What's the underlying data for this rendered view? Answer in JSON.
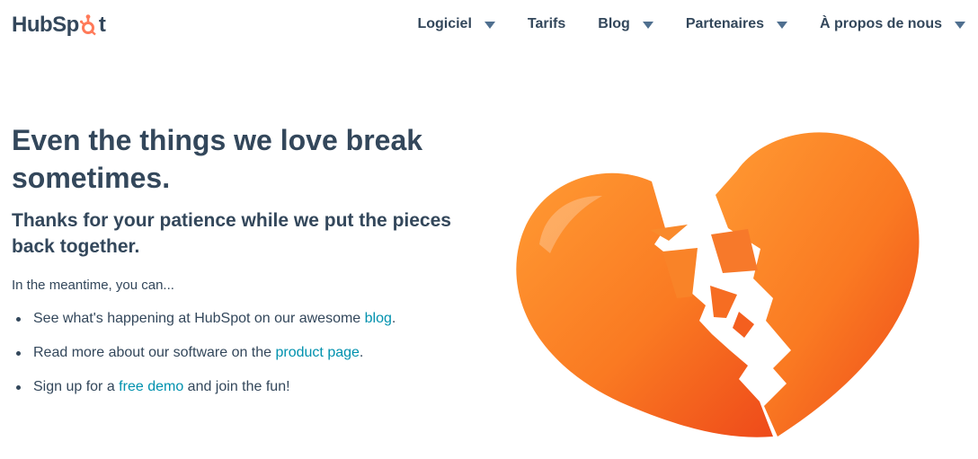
{
  "brand": {
    "logo_text_left": "HubSp",
    "logo_text_right": "t",
    "accent": "#ff7a59"
  },
  "nav": {
    "items": [
      {
        "label": "Logiciel",
        "has_dropdown": true
      },
      {
        "label": "Tarifs",
        "has_dropdown": false
      },
      {
        "label": "Blog",
        "has_dropdown": true
      },
      {
        "label": "Partenaires",
        "has_dropdown": true
      },
      {
        "label": "À propos de nous",
        "has_dropdown": true
      }
    ]
  },
  "main": {
    "title": "Even the things we love break sometimes.",
    "subtitle": "Thanks for your patience while we put the pieces back together.",
    "intro": "In the meantime, you can...",
    "bullets": [
      {
        "before": "See what's happening at HubSpot on our awesome ",
        "link": "blog",
        "after": "."
      },
      {
        "before": "Read more about our software on the ",
        "link": "product page",
        "after": "."
      },
      {
        "before": "Sign up for a ",
        "link": "free demo",
        "after": " and join the fun!"
      }
    ]
  },
  "colors": {
    "text": "#33475b",
    "link": "#0091ae",
    "heart_light": "#ff8f2b",
    "heart_dark": "#f04f1d"
  },
  "illustration": {
    "icon": "broken-heart-icon"
  }
}
